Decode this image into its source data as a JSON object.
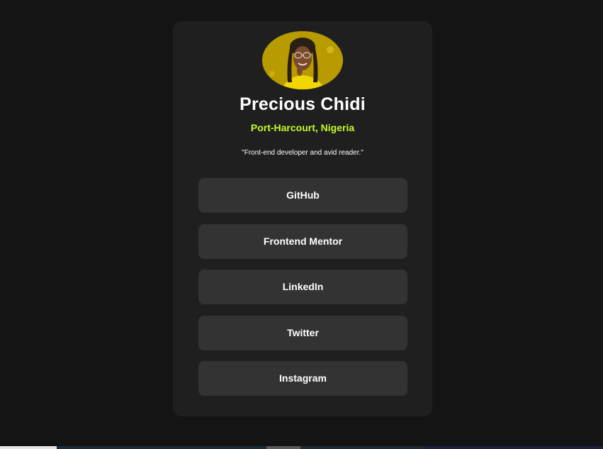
{
  "profile": {
    "name": "Precious Chidi",
    "location": "Port-Harcourt, Nigeria",
    "bio": "\"Front-end developer and avid reader.\""
  },
  "links": [
    {
      "label": "GitHub"
    },
    {
      "label": "Frontend Mentor"
    },
    {
      "label": "LinkedIn"
    },
    {
      "label": "Twitter"
    },
    {
      "label": "Instagram"
    }
  ],
  "colors": {
    "background": "#141414",
    "card": "#1f1f1f",
    "button": "#333333",
    "accent": "#c4f82a",
    "text": "#ffffff"
  }
}
